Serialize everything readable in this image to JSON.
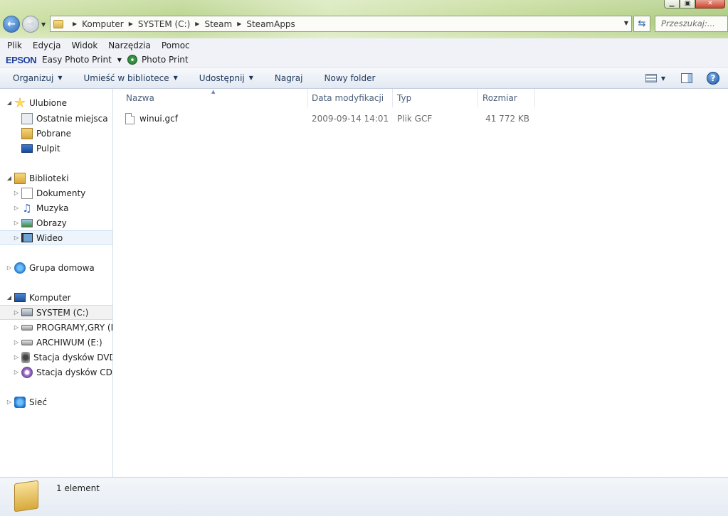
{
  "window": {
    "min_glyph": "▁",
    "max_glyph": "▣",
    "close_glyph": "✕"
  },
  "address_bar": {
    "crumbs": [
      "Komputer",
      "SYSTEM (C:)",
      "Steam",
      "SteamApps"
    ],
    "search_placeholder": "Przeszukaj:..."
  },
  "menu": [
    "Plik",
    "Edycja",
    "Widok",
    "Narzędzia",
    "Pomoc"
  ],
  "epson_bar": {
    "logo": "EPSON",
    "easy_photo_print": "Easy Photo Print",
    "photo_print": "Photo Print"
  },
  "command_bar": {
    "organize": "Organizuj",
    "include_in_library": "Umieść w bibliotece",
    "share": "Udostępnij",
    "burn": "Nagraj",
    "new_folder": "Nowy folder"
  },
  "nav_pane": {
    "favorites": "Ulubione",
    "recent": "Ostatnie miejsca",
    "downloads": "Pobrane",
    "desktop": "Pulpit",
    "libraries": "Biblioteki",
    "documents": "Dokumenty",
    "music": "Muzyka",
    "pictures": "Obrazy",
    "videos": "Wideo",
    "homegroup": "Grupa domowa",
    "computer": "Komputer",
    "drive_c": "SYSTEM (C:)",
    "drive_d": "PROGRAMY,GRY (D:",
    "drive_e": "ARCHIWUM (E:)",
    "dvd": "Stacja dysków DVD R",
    "cd": "Stacja dysków CD (G",
    "network": "Sieć"
  },
  "columns": {
    "name": "Nazwa",
    "date_modified": "Data modyfikacji",
    "type": "Typ",
    "size": "Rozmiar"
  },
  "files": [
    {
      "name": "winui.gcf",
      "date_modified": "2009-09-14 14:01",
      "type": "Plik GCF",
      "size": "41 772 KB"
    }
  ],
  "details_pane": {
    "item_count": "1 element"
  },
  "colors": {
    "accent": "#2867b6",
    "epson_blue": "#1c3e9c"
  }
}
